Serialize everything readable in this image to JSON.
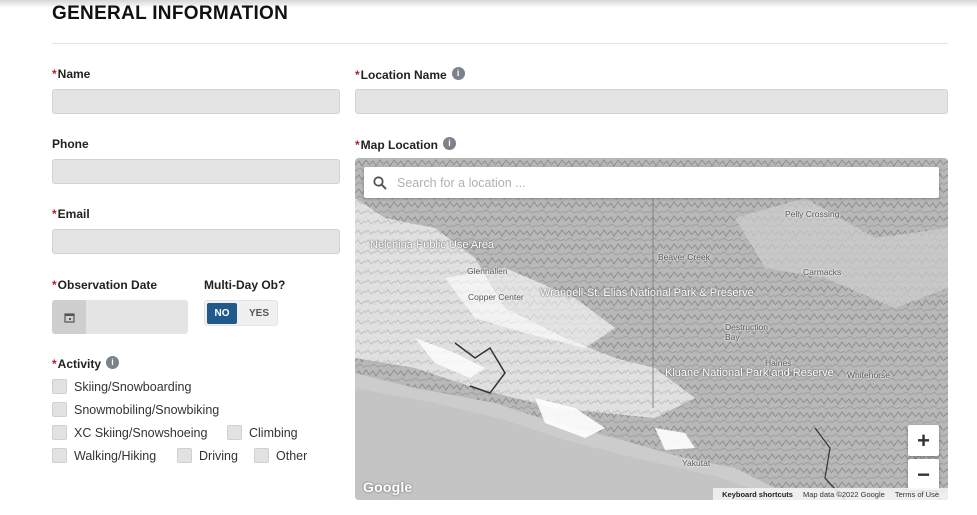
{
  "section": {
    "title": "GENERAL INFORMATION"
  },
  "form": {
    "required_marker": "*",
    "name_label": "Name",
    "name_value": "",
    "phone_label": "Phone",
    "phone_value": "",
    "email_label": "Email",
    "email_value": "",
    "observation_date_label": "Observation Date",
    "observation_date_value": "",
    "multi_day_label": "Multi-Day Ob?",
    "multi_day_no": "NO",
    "multi_day_yes": "YES",
    "multi_day_selected": "NO",
    "location_name_label": "Location Name",
    "location_name_value": "",
    "map_location_label": "Map Location",
    "info_glyph": "i",
    "activity_label": "Activity",
    "activities": [
      {
        "label": "Skiing/Snowboarding",
        "checked": false
      },
      {
        "label": "Snowmobiling/Snowbiking",
        "checked": false
      },
      {
        "label": "XC Skiing/Snowshoeing",
        "checked": false
      },
      {
        "label": "Climbing",
        "checked": false
      },
      {
        "label": "Walking/Hiking",
        "checked": false
      },
      {
        "label": "Driving",
        "checked": false
      },
      {
        "label": "Other",
        "checked": false
      }
    ]
  },
  "map": {
    "search_placeholder": "Search for a location ...",
    "zoom_in": "+",
    "zoom_out": "−",
    "logo": "Google",
    "keyboard_shortcuts": "Keyboard shortcuts",
    "map_data": "Map data ©2022 Google",
    "terms": "Terms of Use",
    "places": [
      {
        "label": "Pelly Crossing"
      },
      {
        "label": "Nelchina Public Use Area"
      },
      {
        "label": "Beaver Creek"
      },
      {
        "label": "Glennallen"
      },
      {
        "label": "Carmacks"
      },
      {
        "label": "Copper Center"
      },
      {
        "label": "Wrangell-St. Elias National Park & Preserve"
      },
      {
        "label": "Destruction Bay"
      },
      {
        "label": "Haines Junction"
      },
      {
        "label": "Whitehorse"
      },
      {
        "label": "Kluane National Park and Reserve"
      },
      {
        "label": "Yakutat"
      }
    ]
  },
  "colors": {
    "required": "#b3212b",
    "toggle_active": "#1f5a8a",
    "input_bg": "#e4e4e4",
    "info_icon": "#7b828a"
  },
  "icons": {
    "info": "info-icon",
    "calendar": "calendar-icon",
    "search": "search-icon"
  }
}
